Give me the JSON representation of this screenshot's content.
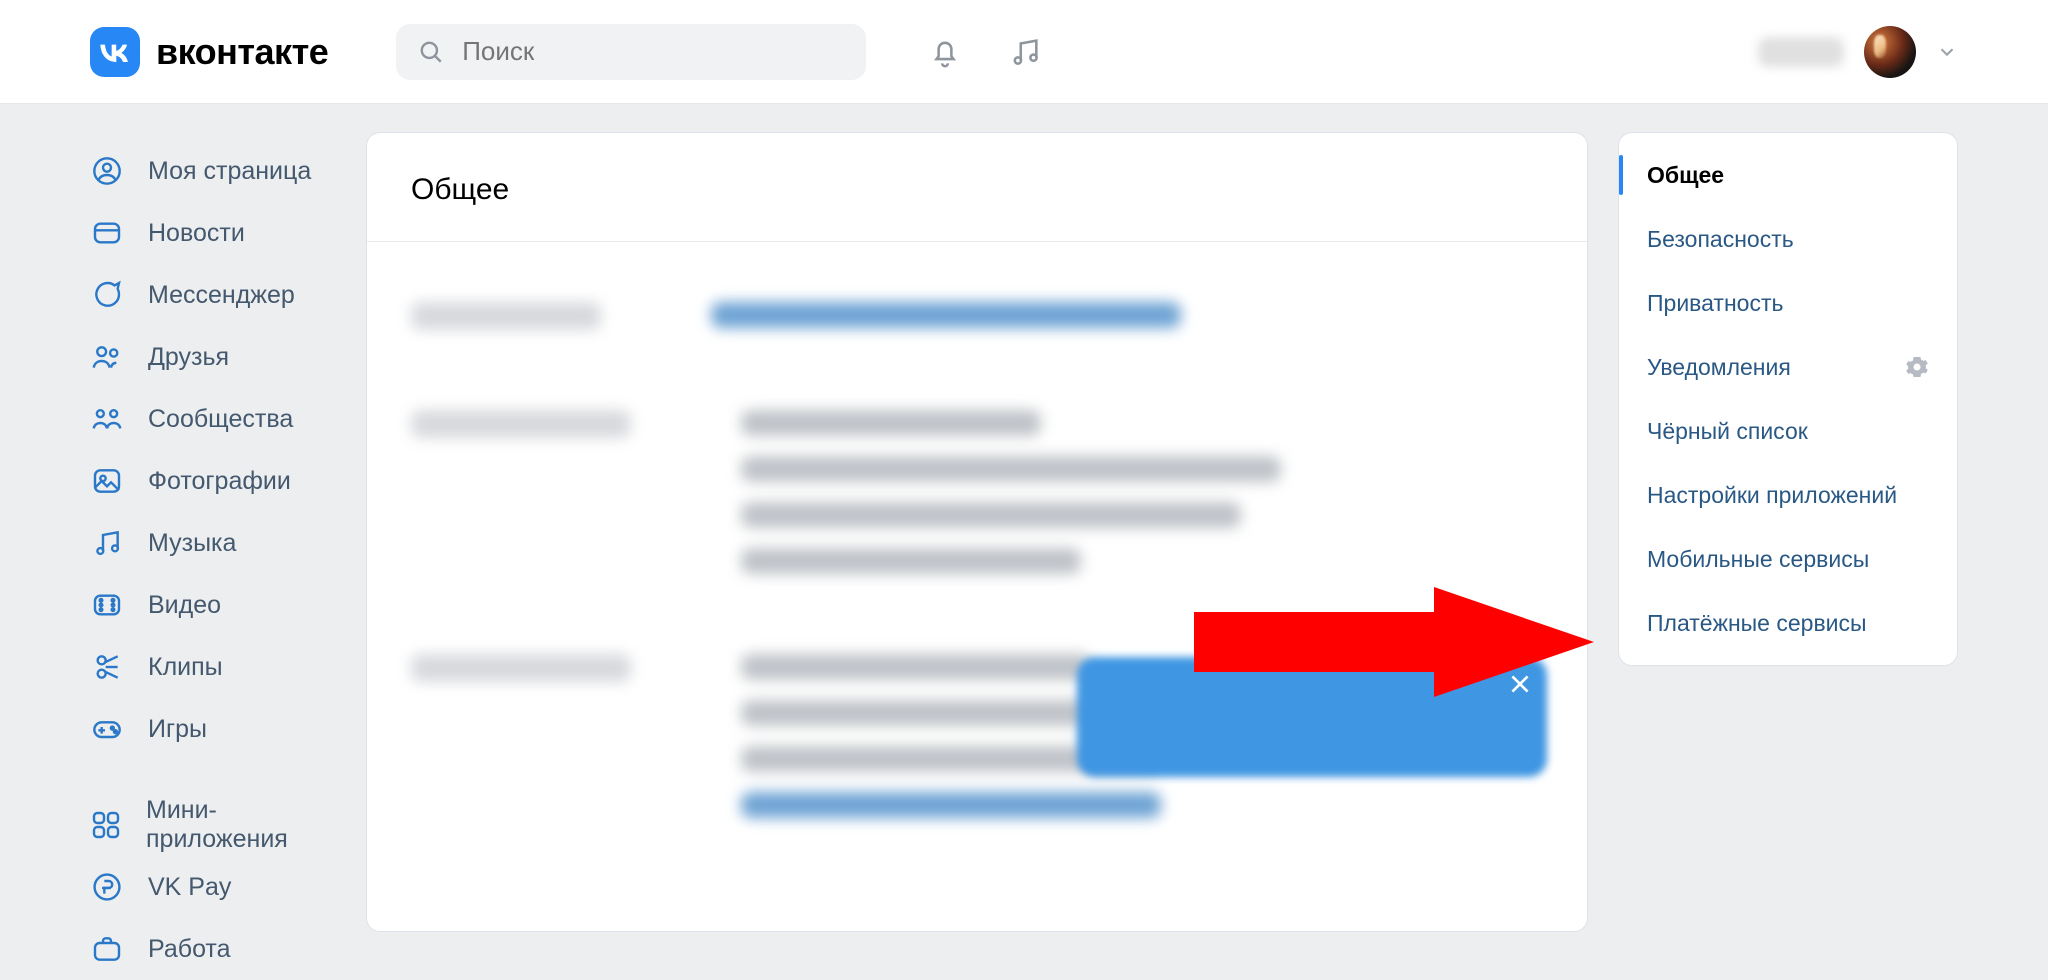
{
  "brand": {
    "name": "вконтакте"
  },
  "search": {
    "placeholder": "Поиск"
  },
  "left_nav": {
    "items": [
      {
        "label": "Моя страница",
        "icon": "user-circle-icon"
      },
      {
        "label": "Новости",
        "icon": "newspaper-icon"
      },
      {
        "label": "Мессенджер",
        "icon": "messenger-icon"
      },
      {
        "label": "Друзья",
        "icon": "friends-icon"
      },
      {
        "label": "Сообщества",
        "icon": "community-icon"
      },
      {
        "label": "Фотографии",
        "icon": "photos-icon"
      },
      {
        "label": "Музыка",
        "icon": "music-note-icon"
      },
      {
        "label": "Видео",
        "icon": "video-icon"
      },
      {
        "label": "Клипы",
        "icon": "clips-icon"
      },
      {
        "label": "Игры",
        "icon": "games-icon"
      }
    ],
    "secondary": [
      {
        "label": "Мини-приложения",
        "icon": "services-icon"
      },
      {
        "label": "VK Pay",
        "icon": "vkpay-icon"
      },
      {
        "label": "Работа",
        "icon": "work-icon"
      }
    ]
  },
  "main": {
    "title": "Общее"
  },
  "settings_nav": {
    "items": [
      {
        "label": "Общее",
        "active": true
      },
      {
        "label": "Безопасность"
      },
      {
        "label": "Приватность"
      },
      {
        "label": "Уведомления",
        "has_gear": true
      },
      {
        "label": "Чёрный список"
      },
      {
        "label": "Настройки приложений"
      },
      {
        "label": "Мобильные сервисы"
      },
      {
        "label": "Платёжные сервисы"
      }
    ]
  },
  "annotation": {
    "target_label": "Платёжные сервисы",
    "color": "#ff0000"
  }
}
